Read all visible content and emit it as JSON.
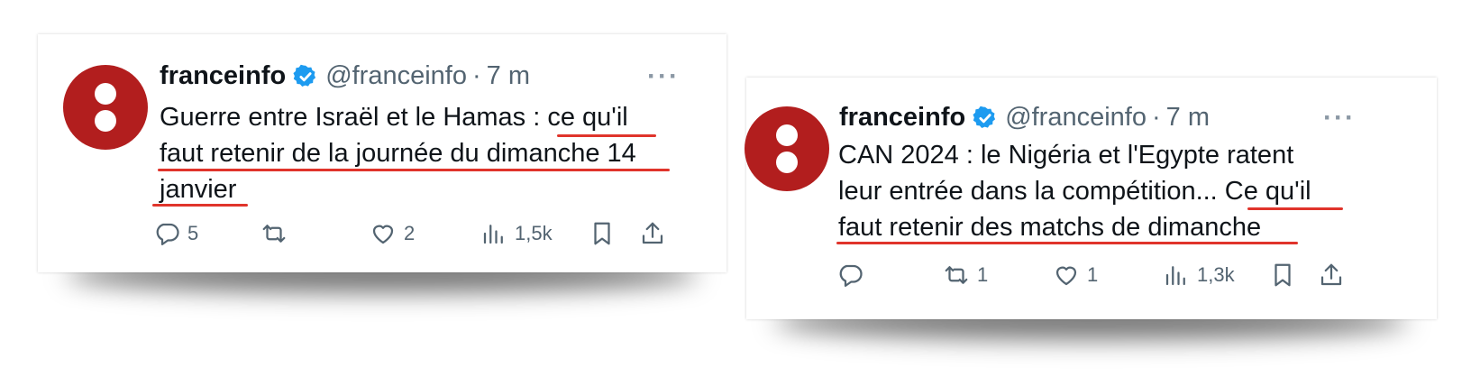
{
  "tweets": [
    {
      "author": {
        "name": "franceinfo",
        "handle": "@franceinfo",
        "separator": "·",
        "time": "7 m"
      },
      "more_label": "···",
      "text_lines": [
        "Guerre entre Israël et le Hamas : ce qu'il",
        "faut retenir de la journée du dimanche 14",
        "janvier"
      ],
      "actions": {
        "replies": "5",
        "retweets": "",
        "likes": "2",
        "views": "1,5k"
      }
    },
    {
      "author": {
        "name": "franceinfo",
        "handle": "@franceinfo",
        "separator": "·",
        "time": "7 m"
      },
      "more_label": "···",
      "text_lines": [
        "CAN 2024 : le Nigéria et l'Egypte ratent",
        "leur entrée dans la compétition... Ce qu'il",
        "faut retenir des matchs de dimanche"
      ],
      "actions": {
        "replies": "",
        "retweets": "1",
        "likes": "1",
        "views": "1,3k"
      }
    }
  ],
  "colors": {
    "avatar": "#b21e1e",
    "verified": "#1d9bf0",
    "underline": "#e0342b",
    "muted": "#536471"
  }
}
